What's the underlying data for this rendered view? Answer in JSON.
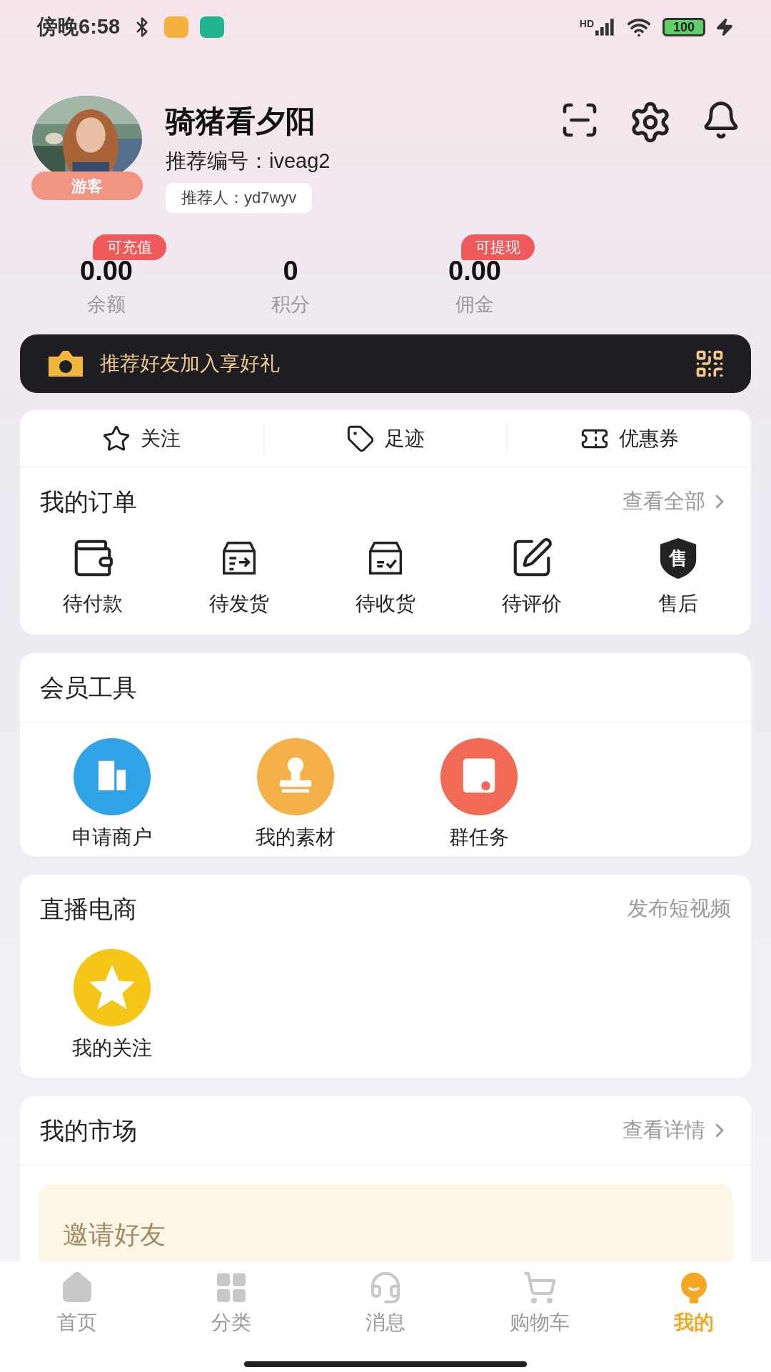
{
  "status_bar": {
    "time": "傍晚6:58",
    "network": "HD",
    "battery": "100"
  },
  "profile": {
    "name": "骑猪看夕阳",
    "role_tag": "游客",
    "referral_code": "推荐编号：iveag2",
    "referrer": "推荐人：yd7wyv"
  },
  "stats": [
    {
      "value": "0.00",
      "label": "余额",
      "badge": "可充值"
    },
    {
      "value": "0",
      "label": "积分"
    },
    {
      "value": "0.00",
      "label": "佣金",
      "badge": "可提现"
    }
  ],
  "invite_banner": {
    "text": "推荐好友加入享好礼"
  },
  "quick_links": [
    {
      "kind": "star",
      "label": "关注"
    },
    {
      "kind": "tag",
      "label": "足迹"
    },
    {
      "kind": "ticket",
      "label": "优惠券"
    }
  ],
  "orders": {
    "title": "我的订单",
    "link": "查看全部",
    "items": [
      {
        "kind": "wallet",
        "label": "待付款"
      },
      {
        "kind": "ship",
        "label": "待发货"
      },
      {
        "kind": "receive",
        "label": "待收货"
      },
      {
        "kind": "review",
        "label": "待评价"
      },
      {
        "kind": "aftersale",
        "label": "售后",
        "glyph": "售"
      }
    ]
  },
  "member_tools": {
    "title": "会员工具",
    "items": [
      {
        "kind": "building",
        "label": "申请商户",
        "color": "#2fa3e6"
      },
      {
        "kind": "stamp",
        "label": "我的素材",
        "color": "#f5b04a"
      },
      {
        "kind": "task",
        "label": "群任务",
        "color": "#f06a55"
      }
    ]
  },
  "live": {
    "title": "直播电商",
    "link": "发布短视频",
    "items": [
      {
        "kind": "star",
        "label": "我的关注",
        "color": "#f5c518"
      }
    ]
  },
  "market": {
    "title": "我的市场",
    "link": "查看详情",
    "invite_title": "邀请好友"
  },
  "tab_bar": [
    {
      "kind": "home",
      "label": "首页",
      "selected": false
    },
    {
      "kind": "grid",
      "label": "分类",
      "selected": false
    },
    {
      "kind": "headset",
      "label": "消息",
      "selected": false
    },
    {
      "kind": "cart",
      "label": "购物车",
      "selected": false
    },
    {
      "kind": "me",
      "label": "我的",
      "selected": true
    }
  ]
}
